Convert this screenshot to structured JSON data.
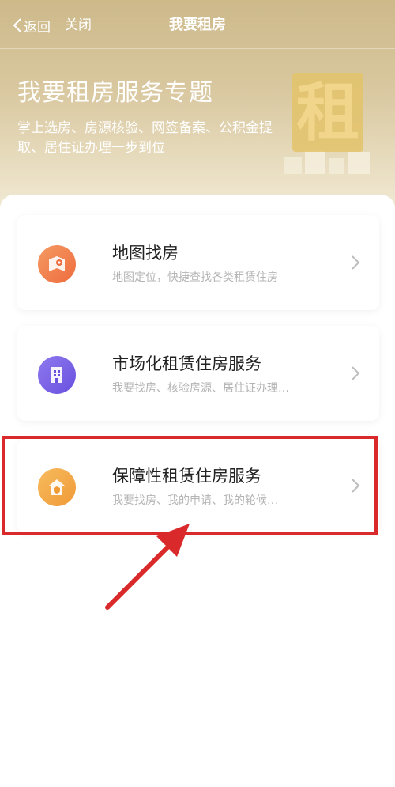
{
  "navbar": {
    "back_label": "返回",
    "close_label": "关闭",
    "title": "我要租房"
  },
  "banner": {
    "title": "我要租房服务专题",
    "description": "掌上选房、房源核验、网签备案、公积金提取、居住证办理一步到位",
    "decor_char": "租"
  },
  "services": [
    {
      "title": "地图找房",
      "subtitle": "地图定位，快捷查找各类租赁住房",
      "icon": "map-pin-icon",
      "icon_color": "#f0794a"
    },
    {
      "title": "市场化租赁住房服务",
      "subtitle": "我要找房、核验房源、居住证办理…",
      "icon": "building-icon",
      "icon_color": "#7a62e6"
    },
    {
      "title": "保障性租赁住房服务",
      "subtitle": "我要找房、我的申请、我的轮候…",
      "icon": "house-shield-icon",
      "icon_color": "#f3a445"
    }
  ],
  "colors": {
    "header_gold": "#cdb98a",
    "highlight_red": "#d9292a",
    "subtitle_gray": "#b4b4b4"
  }
}
